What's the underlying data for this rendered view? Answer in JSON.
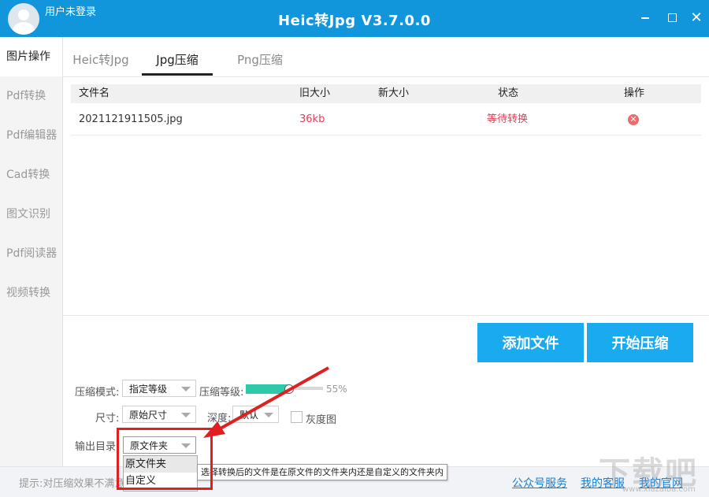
{
  "window": {
    "title": "Heic转Jpg V3.7.0.0",
    "user_label": "用户未登录",
    "controls": {
      "minimize_icon": "minimize-icon",
      "maximize_icon": "maximize-icon",
      "close_icon": "close-icon"
    }
  },
  "sidebar": {
    "items": [
      {
        "label": "图片操作",
        "active": true
      },
      {
        "label": "Pdf转换"
      },
      {
        "label": "Pdf编辑器"
      },
      {
        "label": "Cad转换"
      },
      {
        "label": "图文识别"
      },
      {
        "label": "Pdf阅读器"
      },
      {
        "label": "视频转换"
      }
    ]
  },
  "tabs": [
    {
      "label": "Heic转Jpg"
    },
    {
      "label": "Jpg压缩",
      "active": true
    },
    {
      "label": "Png压缩"
    }
  ],
  "table": {
    "headers": [
      "文件名",
      "旧大小",
      "新大小",
      "状态",
      "操作"
    ],
    "rows": [
      {
        "name": "2021121911505.jpg",
        "old_size": "36kb",
        "new_size": "",
        "status": "等待转换",
        "op_icon": "delete-icon"
      }
    ]
  },
  "buttons": {
    "add": "添加文件",
    "start": "开始压缩"
  },
  "options": {
    "mode_label": "压缩模式:",
    "mode_value": "指定等级",
    "level_label": "压缩等级:",
    "level_value": "55%",
    "level_fraction": 0.55,
    "size_label": "尺寸:",
    "size_value": "原始尺寸",
    "depth_label": "深度:",
    "depth_value": "默认",
    "gray_label": "灰度图",
    "output_label": "输出目录",
    "output_value": "原文件夹",
    "output_options": [
      "原文件夹",
      "自定义"
    ]
  },
  "tooltip": "选择转换后的文件是在原文件的文件夹内还是自定义的文件夹内",
  "footer": {
    "tip": "提示:对压缩效果不满意",
    "links": [
      "公众号服务",
      "我的客服",
      "我的官网"
    ]
  },
  "colors": {
    "accent": "#1296db",
    "button": "#1aaaf0",
    "warn": "#e0405a",
    "highlight": "#e02020"
  },
  "watermark": {
    "text": "下载吧",
    "url": "www.xiazaiba.com"
  }
}
